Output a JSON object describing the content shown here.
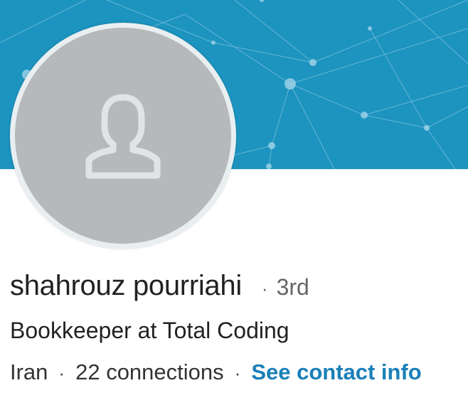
{
  "profile": {
    "name": "shahrouz pourriahi",
    "separator": "·",
    "degree": "3rd",
    "headline": "Bookkeeper at Total Coding",
    "location": "Iran",
    "connections": "22 connections",
    "contact_link": "See contact info"
  },
  "icons": {
    "avatar": "person-silhouette-icon",
    "banner": "network-pattern-icon"
  },
  "colors": {
    "banner": "#1d93bf",
    "avatar_placeholder": "#b7b8ba",
    "link": "#1a7fb8",
    "text_primary": "#222222",
    "text_secondary": "#666666"
  }
}
